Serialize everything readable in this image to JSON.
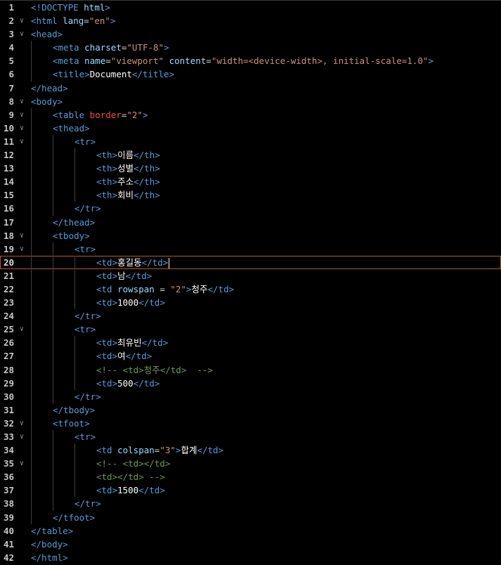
{
  "editor": {
    "current_line": 20,
    "lines": [
      {
        "n": "1",
        "fold": false,
        "depth": 0,
        "tokens": [
          {
            "t": "<!",
            "c": "tag"
          },
          {
            "t": "DOCTYPE",
            "c": "tag"
          },
          {
            "t": " html",
            "c": "attr"
          },
          {
            "t": ">",
            "c": "tag"
          }
        ]
      },
      {
        "n": "2",
        "fold": true,
        "depth": 0,
        "tokens": [
          {
            "t": "<html",
            "c": "tag"
          },
          {
            "t": " lang",
            "c": "attr"
          },
          {
            "t": "=",
            "c": "pun"
          },
          {
            "t": "\"en\"",
            "c": "str"
          },
          {
            "t": ">",
            "c": "tag"
          }
        ]
      },
      {
        "n": "3",
        "fold": true,
        "depth": 0,
        "tokens": [
          {
            "t": "<head>",
            "c": "tag"
          }
        ]
      },
      {
        "n": "4",
        "fold": false,
        "depth": 1,
        "tokens": [
          {
            "t": "<meta",
            "c": "tag"
          },
          {
            "t": " charset",
            "c": "attr"
          },
          {
            "t": "=",
            "c": "pun"
          },
          {
            "t": "\"UTF-8\"",
            "c": "str"
          },
          {
            "t": ">",
            "c": "tag"
          }
        ]
      },
      {
        "n": "5",
        "fold": false,
        "depth": 1,
        "tokens": [
          {
            "t": "<meta",
            "c": "tag"
          },
          {
            "t": " name",
            "c": "attr"
          },
          {
            "t": "=",
            "c": "pun"
          },
          {
            "t": "\"viewport\"",
            "c": "str"
          },
          {
            "t": " content",
            "c": "attr"
          },
          {
            "t": "=",
            "c": "pun"
          },
          {
            "t": "\"width=<device-width>, initial-scale=1.0\"",
            "c": "str"
          },
          {
            "t": ">",
            "c": "tag"
          }
        ]
      },
      {
        "n": "6",
        "fold": false,
        "depth": 1,
        "tokens": [
          {
            "t": "<title>",
            "c": "tag"
          },
          {
            "t": "Document",
            "c": "txt"
          },
          {
            "t": "</title>",
            "c": "tag"
          }
        ]
      },
      {
        "n": "7",
        "fold": false,
        "depth": 0,
        "tokens": [
          {
            "t": "</head>",
            "c": "tag"
          }
        ]
      },
      {
        "n": "8",
        "fold": true,
        "depth": 0,
        "tokens": [
          {
            "t": "<body>",
            "c": "tag"
          }
        ]
      },
      {
        "n": "9",
        "fold": true,
        "depth": 1,
        "tokens": [
          {
            "t": "<table",
            "c": "tag"
          },
          {
            "t": " border",
            "c": "attr red"
          },
          {
            "t": "=",
            "c": "pun"
          },
          {
            "t": "\"2\"",
            "c": "str"
          },
          {
            "t": ">",
            "c": "tag"
          }
        ]
      },
      {
        "n": "10",
        "fold": true,
        "depth": 1,
        "tokens": [
          {
            "t": "<thead>",
            "c": "tag"
          }
        ]
      },
      {
        "n": "11",
        "fold": true,
        "depth": 2,
        "tokens": [
          {
            "t": "<tr>",
            "c": "tag"
          }
        ]
      },
      {
        "n": "12",
        "fold": false,
        "depth": 3,
        "tokens": [
          {
            "t": "<th>",
            "c": "tag"
          },
          {
            "t": "이름",
            "c": "txt"
          },
          {
            "t": "</th>",
            "c": "tag"
          }
        ]
      },
      {
        "n": "13",
        "fold": false,
        "depth": 3,
        "tokens": [
          {
            "t": "<th>",
            "c": "tag"
          },
          {
            "t": "성별",
            "c": "txt"
          },
          {
            "t": "</th>",
            "c": "tag"
          }
        ]
      },
      {
        "n": "14",
        "fold": false,
        "depth": 3,
        "tokens": [
          {
            "t": "<th>",
            "c": "tag"
          },
          {
            "t": "주소",
            "c": "txt"
          },
          {
            "t": "</th>",
            "c": "tag"
          }
        ]
      },
      {
        "n": "15",
        "fold": false,
        "depth": 3,
        "tokens": [
          {
            "t": "<th>",
            "c": "tag"
          },
          {
            "t": "회비",
            "c": "txt"
          },
          {
            "t": "</th>",
            "c": "tag"
          }
        ]
      },
      {
        "n": "16",
        "fold": false,
        "depth": 2,
        "tokens": [
          {
            "t": "</tr>",
            "c": "tag"
          }
        ]
      },
      {
        "n": "17",
        "fold": false,
        "depth": 1,
        "tokens": [
          {
            "t": "</thead>",
            "c": "tag"
          }
        ]
      },
      {
        "n": "18",
        "fold": true,
        "depth": 1,
        "tokens": [
          {
            "t": "<tbody>",
            "c": "tag"
          }
        ]
      },
      {
        "n": "19",
        "fold": true,
        "depth": 2,
        "tokens": [
          {
            "t": "<tr>",
            "c": "tag"
          }
        ]
      },
      {
        "n": "20",
        "fold": false,
        "depth": 3,
        "caret": true,
        "tokens": [
          {
            "t": "<td>",
            "c": "tag"
          },
          {
            "t": "홍길동",
            "c": "txt"
          },
          {
            "t": "</td>",
            "c": "tag"
          }
        ]
      },
      {
        "n": "21",
        "fold": false,
        "depth": 3,
        "tokens": [
          {
            "t": "<td>",
            "c": "tag"
          },
          {
            "t": "남",
            "c": "txt"
          },
          {
            "t": "</td>",
            "c": "tag"
          }
        ]
      },
      {
        "n": "22",
        "fold": false,
        "depth": 3,
        "tokens": [
          {
            "t": "<td",
            "c": "tag"
          },
          {
            "t": " rowspan",
            "c": "attr"
          },
          {
            "t": " = ",
            "c": "pun"
          },
          {
            "t": "\"2\"",
            "c": "str"
          },
          {
            "t": ">",
            "c": "tag"
          },
          {
            "t": "청주",
            "c": "txt"
          },
          {
            "t": "</td>",
            "c": "tag"
          }
        ]
      },
      {
        "n": "23",
        "fold": false,
        "depth": 3,
        "tokens": [
          {
            "t": "<td>",
            "c": "tag"
          },
          {
            "t": "1000",
            "c": "txt"
          },
          {
            "t": "</td>",
            "c": "tag"
          }
        ]
      },
      {
        "n": "24",
        "fold": false,
        "depth": 2,
        "tokens": [
          {
            "t": "</tr>",
            "c": "tag"
          }
        ]
      },
      {
        "n": "25",
        "fold": true,
        "depth": 2,
        "tokens": [
          {
            "t": "<tr>",
            "c": "tag"
          }
        ]
      },
      {
        "n": "26",
        "fold": false,
        "depth": 3,
        "tokens": [
          {
            "t": "<td>",
            "c": "tag"
          },
          {
            "t": "최유빈",
            "c": "txt"
          },
          {
            "t": "</td>",
            "c": "tag"
          }
        ]
      },
      {
        "n": "27",
        "fold": false,
        "depth": 3,
        "tokens": [
          {
            "t": "<td>",
            "c": "tag"
          },
          {
            "t": "여",
            "c": "txt"
          },
          {
            "t": "</td>",
            "c": "tag"
          }
        ]
      },
      {
        "n": "28",
        "fold": false,
        "depth": 3,
        "tokens": [
          {
            "t": "<!-- <td>청주</td>  -->",
            "c": "cmt"
          }
        ]
      },
      {
        "n": "29",
        "fold": false,
        "depth": 3,
        "tokens": [
          {
            "t": "<td>",
            "c": "tag"
          },
          {
            "t": "500",
            "c": "txt"
          },
          {
            "t": "</td>",
            "c": "tag"
          }
        ]
      },
      {
        "n": "30",
        "fold": false,
        "depth": 2,
        "tokens": [
          {
            "t": "</tr>",
            "c": "tag"
          }
        ]
      },
      {
        "n": "31",
        "fold": false,
        "depth": 1,
        "tokens": [
          {
            "t": "</tbody>",
            "c": "tag"
          }
        ]
      },
      {
        "n": "32",
        "fold": true,
        "depth": 1,
        "tokens": [
          {
            "t": "<tfoot>",
            "c": "tag"
          }
        ]
      },
      {
        "n": "33",
        "fold": true,
        "depth": 2,
        "tokens": [
          {
            "t": "<tr>",
            "c": "tag"
          }
        ]
      },
      {
        "n": "34",
        "fold": false,
        "depth": 3,
        "tokens": [
          {
            "t": "<td",
            "c": "tag"
          },
          {
            "t": " colspan",
            "c": "attr"
          },
          {
            "t": "=",
            "c": "pun"
          },
          {
            "t": "\"3\"",
            "c": "str"
          },
          {
            "t": ">",
            "c": "tag"
          },
          {
            "t": "합계",
            "c": "txt"
          },
          {
            "t": "</td>",
            "c": "tag"
          }
        ]
      },
      {
        "n": "35",
        "fold": true,
        "depth": 3,
        "tokens": [
          {
            "t": "<!-- <td></td>",
            "c": "cmt"
          }
        ]
      },
      {
        "n": "36",
        "fold": false,
        "depth": 3,
        "tokens": [
          {
            "t": "<td></td> -->",
            "c": "cmt"
          }
        ]
      },
      {
        "n": "37",
        "fold": false,
        "depth": 3,
        "tokens": [
          {
            "t": "<td>",
            "c": "tag"
          },
          {
            "t": "1500",
            "c": "txt"
          },
          {
            "t": "</td>",
            "c": "tag"
          }
        ]
      },
      {
        "n": "38",
        "fold": false,
        "depth": 2,
        "tokens": [
          {
            "t": "</tr>",
            "c": "tag"
          }
        ]
      },
      {
        "n": "39",
        "fold": false,
        "depth": 1,
        "tokens": [
          {
            "t": "</tfoot>",
            "c": "tag"
          }
        ]
      },
      {
        "n": "40",
        "fold": false,
        "depth": 0,
        "tokens": [
          {
            "t": "</table>",
            "c": "tag"
          }
        ]
      },
      {
        "n": "41",
        "fold": false,
        "depth": 0,
        "tokens": [
          {
            "t": "</body>",
            "c": "tag"
          }
        ]
      },
      {
        "n": "42",
        "fold": false,
        "depth": 0,
        "tokens": [
          {
            "t": "</html>",
            "c": "tag"
          }
        ]
      }
    ],
    "fold_icon": "chevron-down-icon",
    "colors": {
      "background": "#000000",
      "tag": "#569cd6",
      "attribute": "#9cdcfe",
      "string": "#ce9178",
      "comment": "#6a9955",
      "text": "#ffffff",
      "current_line_border": "#b35a1a"
    }
  }
}
